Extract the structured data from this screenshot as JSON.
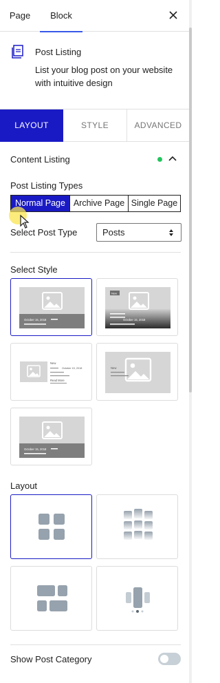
{
  "header": {
    "tabs": [
      {
        "label": "Page"
      },
      {
        "label": "Block"
      }
    ],
    "active_tab": "Block"
  },
  "block": {
    "title": "Post Listing",
    "description": "List your blog post on your website with intuitive design"
  },
  "main_tabs": [
    {
      "label": "LAYOUT",
      "active": true
    },
    {
      "label": "STYLE",
      "active": false
    },
    {
      "label": "ADVANCED",
      "active": false
    }
  ],
  "content_listing": {
    "title": "Content Listing",
    "status_color": "#22c55e",
    "post_listing_types": {
      "label": "Post Listing Types",
      "options": [
        "Normal Page",
        "Archive Page",
        "Single Page"
      ],
      "selected": "Normal Page"
    },
    "post_type": {
      "label": "Select Post Type",
      "value": "Posts"
    }
  },
  "select_style": {
    "label": "Select Style",
    "cards": [
      {
        "date": "October 15, 2018",
        "selected": true
      },
      {
        "tag": "New",
        "date": "October 15, 2018",
        "selected": false
      },
      {
        "tag": "New",
        "date": "October 15, 2018",
        "read_more": "Read More",
        "selected": false
      },
      {
        "tag": "New",
        "selected": false
      },
      {
        "date": "October 15, 2018",
        "selected": false
      }
    ]
  },
  "layout": {
    "label": "Layout",
    "options_count": 4,
    "selected_index": 0
  },
  "show_post_category": {
    "label": "Show Post Category",
    "enabled": false
  },
  "colors": {
    "accent": "#1a1ac5",
    "tab_underline": "#3858e9"
  }
}
